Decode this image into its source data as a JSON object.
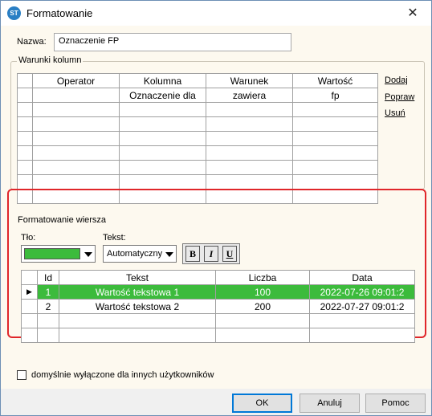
{
  "window": {
    "title": "Formatowanie",
    "icon": "app-logo-icon",
    "close_glyph": "✕"
  },
  "name_field": {
    "label": "Nazwa:",
    "value": "Oznaczenie FP"
  },
  "column_conditions": {
    "legend": "Warunki kolumn",
    "headers": [
      "",
      "Operator",
      "Kolumna",
      "Warunek",
      "Wartość"
    ],
    "rows": [
      [
        "",
        "",
        "Oznaczenie dla",
        "zawiera",
        "fp"
      ],
      [
        "",
        "",
        "",
        "",
        ""
      ],
      [
        "",
        "",
        "",
        "",
        ""
      ],
      [
        "",
        "",
        "",
        "",
        ""
      ],
      [
        "",
        "",
        "",
        "",
        ""
      ],
      [
        "",
        "",
        "",
        "",
        ""
      ],
      [
        "",
        "",
        "",
        "",
        ""
      ],
      [
        "",
        "",
        "",
        "",
        ""
      ]
    ],
    "actions": {
      "add": "Dodaj",
      "edit": "Popraw",
      "delete": "Usuń"
    }
  },
  "row_formatting": {
    "legend": "Formatowanie wiersza",
    "background_label": "Tło:",
    "background_color": "#3cbb3c",
    "text_label": "Tekst:",
    "text_color_value": "Automatyczny",
    "bold_glyph": "B",
    "italic_glyph": "I",
    "underline_glyph": "U",
    "preview": {
      "headers": [
        "",
        "Id",
        "Tekst",
        "Liczba",
        "Data"
      ],
      "rows": [
        [
          "▶",
          "1",
          "Wartość tekstowa 1",
          "100",
          "2022-07-26 09:01:2"
        ],
        [
          "",
          "2",
          "Wartość tekstowa 2",
          "200",
          "2022-07-27 09:01:2"
        ],
        [
          "",
          "",
          "",
          "",
          ""
        ],
        [
          "",
          "",
          "",
          "",
          ""
        ]
      ]
    }
  },
  "default_disabled": {
    "label": "domyślnie wyłączone dla innych użytkowników",
    "checked": false
  },
  "buttons": {
    "ok": "OK",
    "cancel": "Anuluj",
    "help": "Pomoc"
  },
  "colors": {
    "highlight_frame": "#e0262a",
    "selected_row": "#3cbb3c",
    "client_bg": "#fdf9ef"
  }
}
